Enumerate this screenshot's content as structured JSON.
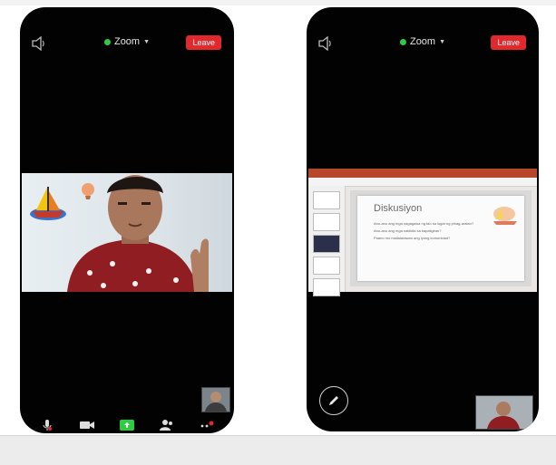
{
  "left_phone": {
    "meeting_name": "Zoom",
    "leave_label": "Leave",
    "icons": [
      "speaker-icon",
      "green-dot",
      "chevron-down-icon",
      "mic-icon",
      "video-icon",
      "share-screen-icon",
      "participants-icon",
      "more-icon"
    ]
  },
  "right_phone": {
    "meeting_name": "Zoom",
    "leave_label": "Leave",
    "slide": {
      "title": "Diskusiyon",
      "bullets": [
        "Ano-ano ang mga nagagawa ng tao sa lugar ng pinag-aralan?",
        "Ano-ano ang mga nakikita sa kapaligiran?",
        "Paano mo mailalarawan ang iyong komunidad?"
      ]
    },
    "icons": [
      "speaker-icon",
      "green-dot",
      "chevron-down-icon",
      "pen-icon"
    ]
  },
  "colors": {
    "leave_red": "#e0282d",
    "status_green": "#2ecc40",
    "phone_black": "#020202",
    "ppt_orange": "#b7472a"
  }
}
